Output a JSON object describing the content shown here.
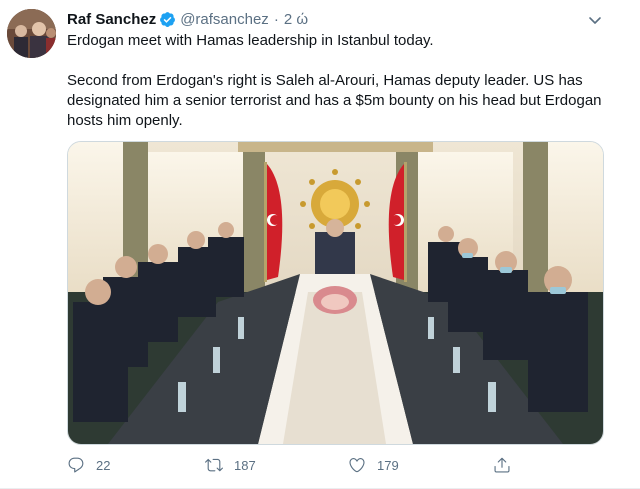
{
  "tweet": {
    "author_name": "Raf Sanchez",
    "handle": "@rafsanchez",
    "separator": "·",
    "time": "2 ώ",
    "text_line1": "Erdogan meet with Hamas leadership in Istanbul today.",
    "text_line2": "Second from Erdogan's right is Saleh al-Arouri, Hamas deputy leader. US has designated him a senior terrorist and has a $5m bounty on his head but Erdogan hosts him openly.",
    "photo_description": ""
  },
  "actions": {
    "reply_count": "22",
    "retweet_count": "187",
    "like_count": "179"
  },
  "icons": {
    "verified": "verified-badge-icon",
    "more": "chevron-down-icon",
    "reply": "reply-icon",
    "retweet": "retweet-icon",
    "like": "heart-icon",
    "share": "share-icon"
  },
  "colors": {
    "text_primary": "#0f1419",
    "text_secondary": "#5b7083",
    "verified": "#1da1f2",
    "border": "#cfd9de"
  }
}
